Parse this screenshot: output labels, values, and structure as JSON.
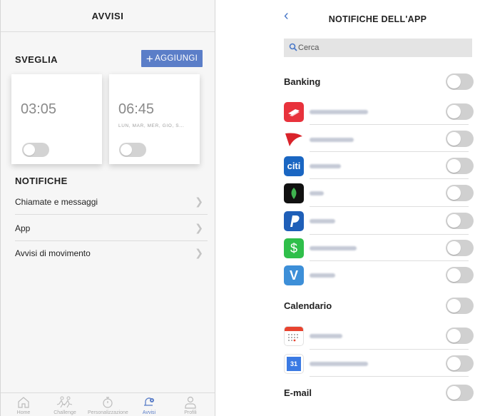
{
  "left_screen": {
    "header": {
      "title": "AVVISI"
    },
    "alarms_section": {
      "title": "SVEGLIA",
      "add_button": {
        "icon": "plus-icon",
        "label": "AGGIUNGI"
      }
    },
    "alarms": [
      {
        "time": "03:05",
        "days": "",
        "enabled": false
      },
      {
        "time": "06:45",
        "days": "LUN, MAR, MER, GIO, S...",
        "enabled": false
      }
    ],
    "notifications_section": {
      "title": "NOTIFICHE"
    },
    "menu_items": [
      {
        "label": "Chiamate e messaggi"
      },
      {
        "label": "App"
      },
      {
        "label": "Avvisi di movimento"
      }
    ],
    "tabbar": [
      {
        "label": "Home",
        "icon": "home-icon",
        "active": false
      },
      {
        "label": "Challenge",
        "icon": "runners-icon",
        "active": false
      },
      {
        "label": "Personalizzazione",
        "icon": "stopwatch-icon",
        "active": false
      },
      {
        "label": "Avvisi",
        "icon": "bell-gear-icon",
        "active": true
      },
      {
        "label": "Profili",
        "icon": "person-icon",
        "active": false
      }
    ],
    "accent_color": "#5b7ec8"
  },
  "right_screen": {
    "header": {
      "title": "NOTIFICHE DELL'APP",
      "back_icon": "chevron-left-icon"
    },
    "search": {
      "placeholder": "Cerca",
      "icon": "search-icon"
    },
    "sections": [
      {
        "title": "Banking",
        "enabled": false,
        "apps": [
          {
            "icon": "bank-of-america-icon",
            "enabled": false
          },
          {
            "icon": "capital-one-icon",
            "enabled": false
          },
          {
            "icon": "citi-icon",
            "icon_text": "citi",
            "enabled": false
          },
          {
            "icon": "mint-icon",
            "enabled": false
          },
          {
            "icon": "paypal-icon",
            "enabled": false
          },
          {
            "icon": "cash-app-icon",
            "icon_text": "$",
            "enabled": false
          },
          {
            "icon": "venmo-icon",
            "icon_text": "V",
            "enabled": false
          }
        ]
      },
      {
        "title": "Calendario",
        "enabled": false,
        "apps": [
          {
            "icon": "calendar-icon",
            "enabled": false
          },
          {
            "icon": "google-calendar-icon",
            "icon_text": "31",
            "enabled": false
          }
        ]
      },
      {
        "title": "E-mail",
        "enabled": false,
        "apps": []
      }
    ]
  }
}
